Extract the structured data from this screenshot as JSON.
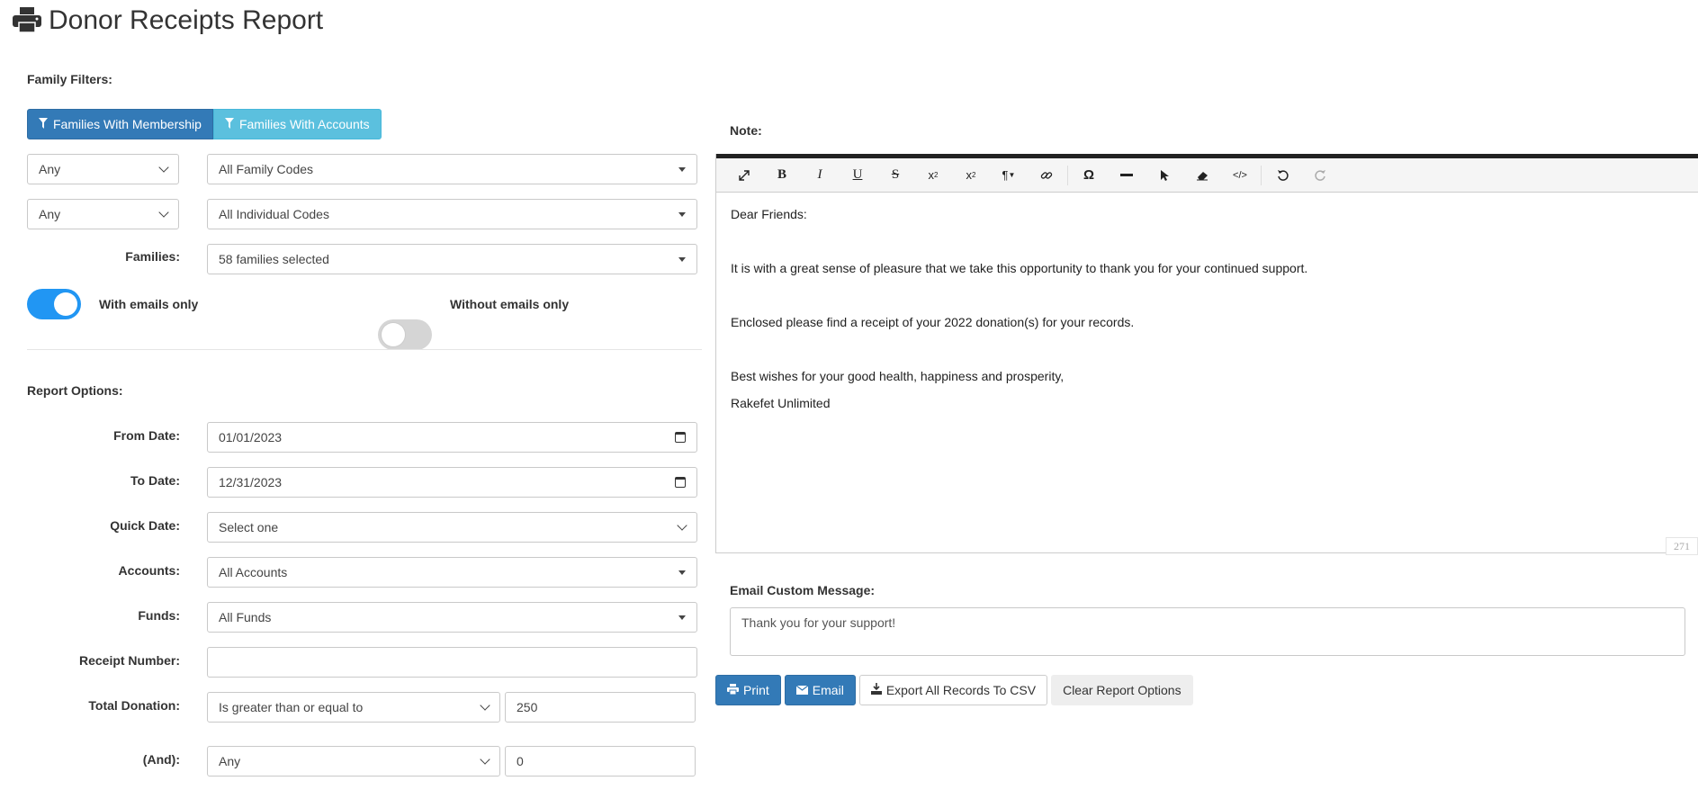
{
  "header": {
    "title": "Donor Receipts Report",
    "icon": "printer-icon"
  },
  "family_filters": {
    "label": "Family Filters:",
    "buttons": [
      "Families With Membership",
      "Families With Accounts"
    ],
    "row1": {
      "any": "Any",
      "codes": "All Family Codes"
    },
    "row2": {
      "any": "Any",
      "codes": "All Individual Codes"
    },
    "families_label": "Families:",
    "families_value": "58 families selected",
    "with_emails_label": "With emails only",
    "with_emails_on": true,
    "without_emails_label": "Without emails only",
    "without_emails_on": false
  },
  "report_options": {
    "label": "Report Options:",
    "from_date_label": "From Date:",
    "from_date": "01/01/2023",
    "to_date_label": "To Date:",
    "to_date": "12/31/2023",
    "quick_date_label": "Quick Date:",
    "quick_date": "Select one",
    "accounts_label": "Accounts:",
    "accounts": "All Accounts",
    "funds_label": "Funds:",
    "funds": "All Funds",
    "receipt_label": "Receipt Number:",
    "receipt_value": "",
    "total_label": "Total Donation:",
    "total_op": "Is greater than or equal to",
    "total_value": "250",
    "and_label": "(And):",
    "and_op": "Any",
    "and_value": "0"
  },
  "note": {
    "label": "Note:",
    "lines": [
      "Dear Friends:",
      "",
      "It is with a great sense of pleasure that we take this opportunity to thank you for your continued support.",
      "",
      "Enclosed please find a receipt of your 2022 donation(s) for your records.",
      "",
      "Best wishes for your good health, happiness and prosperity,",
      "Rakefet Unlimited"
    ],
    "char_count": "271"
  },
  "email": {
    "label": "Email Custom Message:",
    "message": "Thank you for your support!"
  },
  "actions": {
    "print": "Print",
    "email": "Email",
    "export": "Export All Records To CSV",
    "clear": "Clear Report Options"
  }
}
